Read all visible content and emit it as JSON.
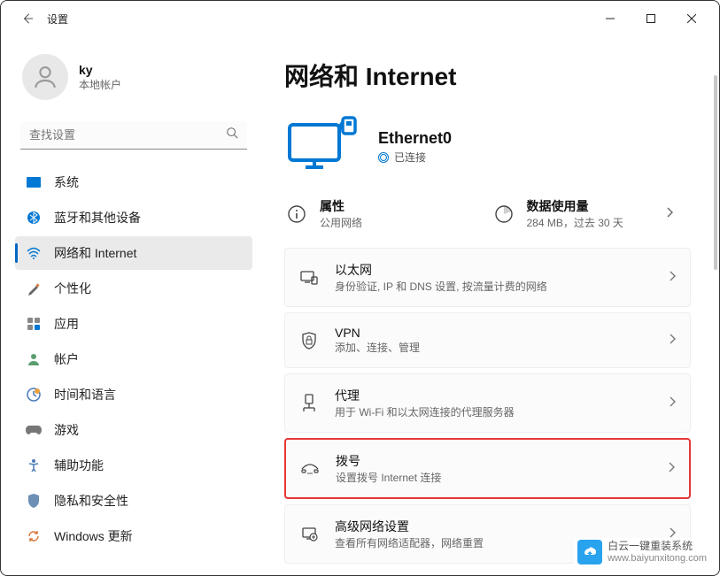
{
  "titlebar": {
    "title": "设置"
  },
  "user": {
    "name": "ky",
    "sub": "本地帐户"
  },
  "search": {
    "placeholder": "查找设置"
  },
  "nav": {
    "items": [
      {
        "label": "系统",
        "icon": "system"
      },
      {
        "label": "蓝牙和其他设备",
        "icon": "bluetooth"
      },
      {
        "label": "网络和 Internet",
        "icon": "network",
        "active": true
      },
      {
        "label": "个性化",
        "icon": "personalize"
      },
      {
        "label": "应用",
        "icon": "apps"
      },
      {
        "label": "帐户",
        "icon": "accounts"
      },
      {
        "label": "时间和语言",
        "icon": "time"
      },
      {
        "label": "游戏",
        "icon": "gaming"
      },
      {
        "label": "辅助功能",
        "icon": "accessibility"
      },
      {
        "label": "隐私和安全性",
        "icon": "privacy"
      },
      {
        "label": "Windows 更新",
        "icon": "update"
      }
    ]
  },
  "page": {
    "title": "网络和 Internet",
    "network": {
      "name": "Ethernet0",
      "status": "已连接"
    },
    "twin": {
      "props": {
        "title": "属性",
        "sub": "公用网络"
      },
      "usage": {
        "title": "数据使用量",
        "sub": "284 MB，过去 30 天"
      }
    },
    "items": {
      "ethernet": {
        "title": "以太网",
        "sub": "身份验证, IP 和 DNS 设置, 按流量计费的网络"
      },
      "vpn": {
        "title": "VPN",
        "sub": "添加、连接、管理"
      },
      "proxy": {
        "title": "代理",
        "sub": "用于 Wi-Fi 和以太网连接的代理服务器"
      },
      "dialup": {
        "title": "拨号",
        "sub": "设置拨号 Internet 连接"
      },
      "advanced": {
        "title": "高级网络设置",
        "sub": "查看所有网络适配器，网络重置"
      }
    }
  },
  "watermark": {
    "title": "白云一键重装系统",
    "url": "www.baiyunxitong.com"
  }
}
